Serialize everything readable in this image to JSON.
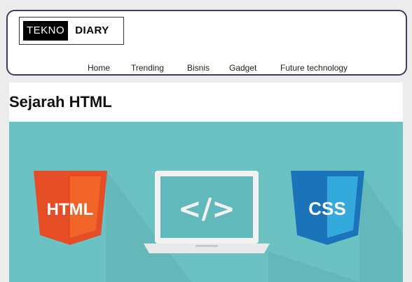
{
  "logo": {
    "part1": "TEKNO",
    "part2": "DIARY"
  },
  "nav": {
    "items": [
      {
        "label": "Home"
      },
      {
        "label": "Trending"
      },
      {
        "label": "Bisnis"
      },
      {
        "label": "Gadget"
      },
      {
        "label": "Future technology"
      }
    ]
  },
  "article": {
    "title": "Sejarah HTML"
  },
  "hero": {
    "html_badge": "HTML",
    "code_symbol": "</>",
    "css_badge": "CSS",
    "colors": {
      "background": "#6cc1c3",
      "html_shield": "#e44d26",
      "html_shield_light": "#f16529",
      "css_shield": "#1b73ba",
      "css_shield_light": "#33a9dc",
      "laptop": "#f2f2f2"
    }
  }
}
